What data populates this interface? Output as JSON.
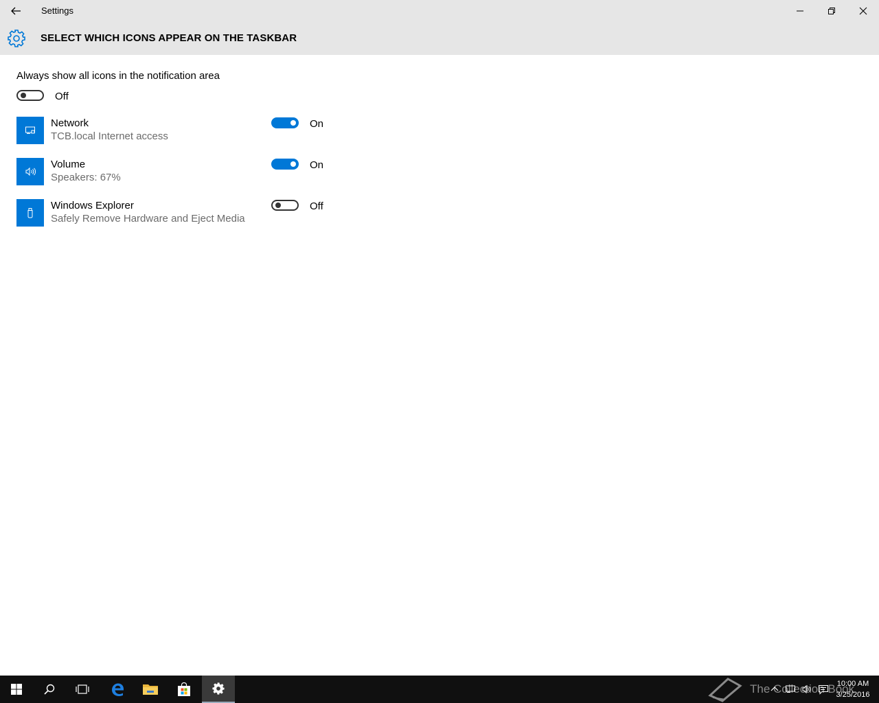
{
  "window": {
    "title": "Settings"
  },
  "header": {
    "title": "SELECT WHICH ICONS APPEAR ON THE TASKBAR"
  },
  "master": {
    "label": "Always show all icons in the notification area",
    "state": "Off"
  },
  "rows": [
    {
      "name": "Network",
      "subtitle": "TCB.local Internet access",
      "state": "On",
      "icon": "network-icon"
    },
    {
      "name": "Volume",
      "subtitle": "Speakers: 67%",
      "state": "On",
      "icon": "volume-icon"
    },
    {
      "name": "Windows Explorer",
      "subtitle": "Safely Remove Hardware and Eject Media",
      "state": "Off",
      "icon": "usb-drive-icon"
    }
  ],
  "taskbar": {
    "watermark": "The Collection Book",
    "time": "10:00 AM",
    "date": "3/25/2016"
  },
  "colors": {
    "accent": "#0078d7",
    "titlebar": "#e6e6e6",
    "taskbar": "#101010"
  }
}
